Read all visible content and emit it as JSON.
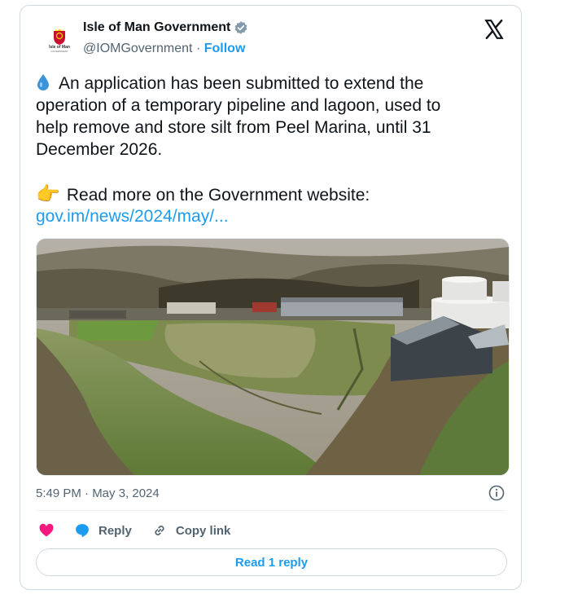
{
  "account": {
    "name": "Isle of Man Government",
    "handle": "@IOMGovernment",
    "separator": "·",
    "follow_label": "Follow",
    "avatar_text": "Isle of Man",
    "avatar_subtext": "GOVERNMENT"
  },
  "tweet": {
    "paragraph": "An application has been submitted to extend the\noperation of a temporary pipeline and lagoon, used to\nhelp remove and store silt from Peel Marina, until 31\nDecember 2026.",
    "read_more": "Read more on the Government website:",
    "link": "gov.im/news/2024/may/...",
    "timestamp": "5:49 PM · May 3, 2024"
  },
  "actions": {
    "reply_label": "Reply",
    "copy_label": "Copy link",
    "read_replies_label": "Read 1 reply"
  },
  "colors": {
    "accent": "#1d9bf0",
    "like": "#f91880",
    "text": "#0f1419",
    "muted": "#536471"
  }
}
